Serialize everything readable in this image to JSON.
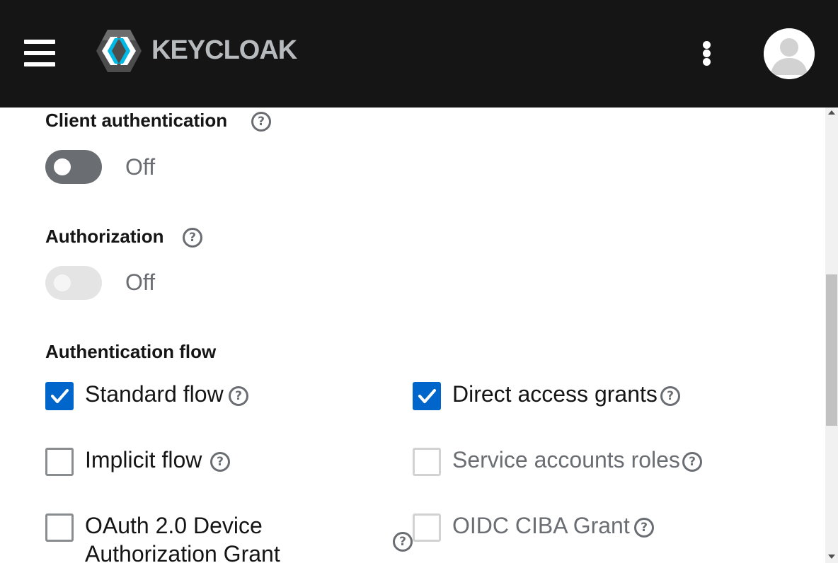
{
  "header": {
    "brand": "KEYCLOAK",
    "menu_icon": "hamburger-icon",
    "kebab_icon": "kebab-icon",
    "avatar_icon": "user-avatar-icon"
  },
  "colors": {
    "masthead": "#151515",
    "checkbox_checked": "#0066cc",
    "switch_off": "#6a6e73",
    "switch_disabled": "#e4e4e4"
  },
  "client_authentication": {
    "label": "Client authentication",
    "state": "Off",
    "enabled": true
  },
  "authorization": {
    "label": "Authorization",
    "state": "Off",
    "enabled": false
  },
  "authentication_flow": {
    "label": "Authentication flow",
    "options": [
      {
        "label": "Standard flow",
        "checked": true,
        "disabled": false
      },
      {
        "label": "Direct access grants",
        "checked": true,
        "disabled": false
      },
      {
        "label": "Implicit flow",
        "checked": false,
        "disabled": false
      },
      {
        "label": "Service accounts roles",
        "checked": false,
        "disabled": true
      },
      {
        "label_line1": "OAuth 2.0 Device",
        "label_line2": "Authorization Grant",
        "checked": false,
        "disabled": false
      },
      {
        "label": "OIDC CIBA Grant",
        "checked": false,
        "disabled": true
      }
    ]
  },
  "help_glyph": "?"
}
